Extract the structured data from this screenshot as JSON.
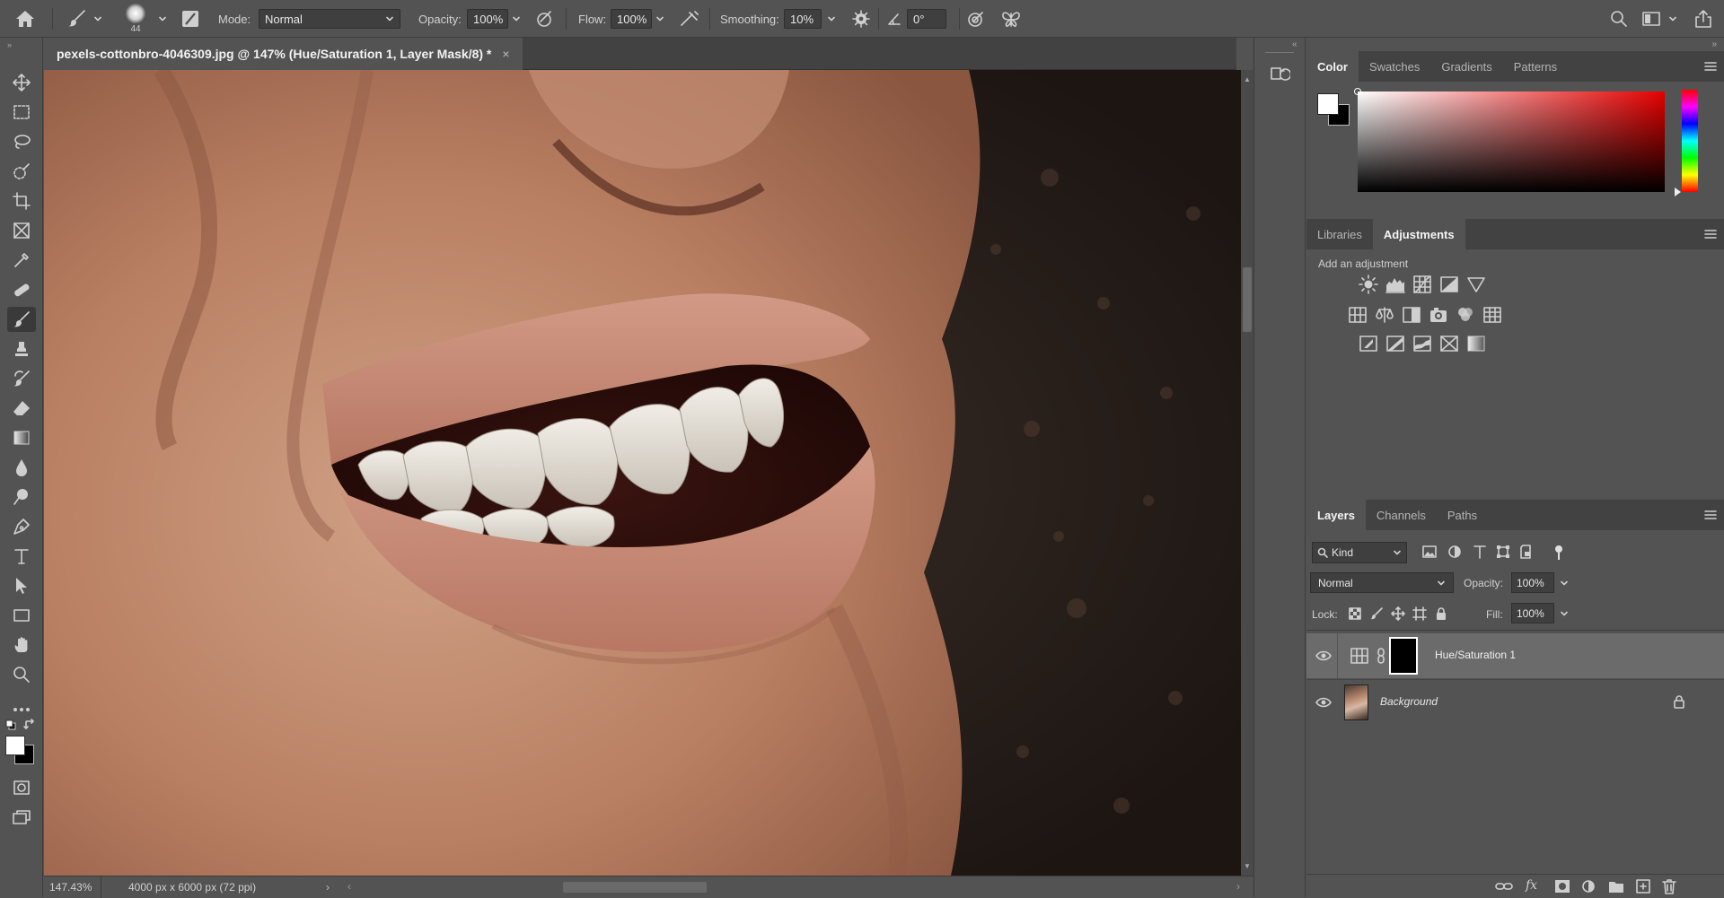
{
  "options_bar": {
    "brush_size": "44",
    "mode_label": "Mode:",
    "mode_value": "Normal",
    "opacity_label": "Opacity:",
    "opacity_value": "100%",
    "flow_label": "Flow:",
    "flow_value": "100%",
    "smoothing_label": "Smoothing:",
    "smoothing_value": "10%",
    "angle_value": "0°"
  },
  "document": {
    "tab_title": "pexels-cottonbro-4046309.jpg @ 147% (Hue/Saturation 1, Layer Mask/8) *",
    "close_glyph": "×"
  },
  "status": {
    "zoom": "147.43%",
    "dimensions": "4000 px x 6000 px (72 ppi)"
  },
  "color_panel": {
    "tabs": [
      "Color",
      "Swatches",
      "Gradients",
      "Patterns"
    ],
    "active_tab": "Color"
  },
  "adjustments_panel": {
    "tabs": [
      "Libraries",
      "Adjustments"
    ],
    "active_tab": "Adjustments",
    "heading": "Add an adjustment",
    "rows": [
      [
        "brightness-contrast-icon",
        "levels-icon",
        "curves-icon",
        "exposure-icon",
        "vibrance-icon"
      ],
      [
        "hue-saturation-icon",
        "color-balance-icon",
        "black-white-icon",
        "photo-filter-icon",
        "channel-mixer-icon",
        "color-lookup-icon"
      ],
      [
        "invert-icon",
        "posterize-icon",
        "threshold-icon",
        "selective-color-icon",
        "gradient-map-icon"
      ]
    ]
  },
  "layers_panel": {
    "tabs": [
      "Layers",
      "Channels",
      "Paths"
    ],
    "active_tab": "Layers",
    "filter_kind": "Kind",
    "blend_mode": "Normal",
    "opacity_label": "Opacity:",
    "opacity_value": "100%",
    "lock_label": "Lock:",
    "fill_label": "Fill:",
    "fill_value": "100%",
    "layers": [
      {
        "name": "Hue/Saturation 1",
        "selected": true,
        "visible": true
      },
      {
        "name": "Background",
        "selected": false,
        "visible": true,
        "locked": true
      }
    ]
  },
  "colors": {
    "ui_bg": "#535353",
    "panel_dark": "#424242",
    "selection": "#6b6b6b"
  }
}
